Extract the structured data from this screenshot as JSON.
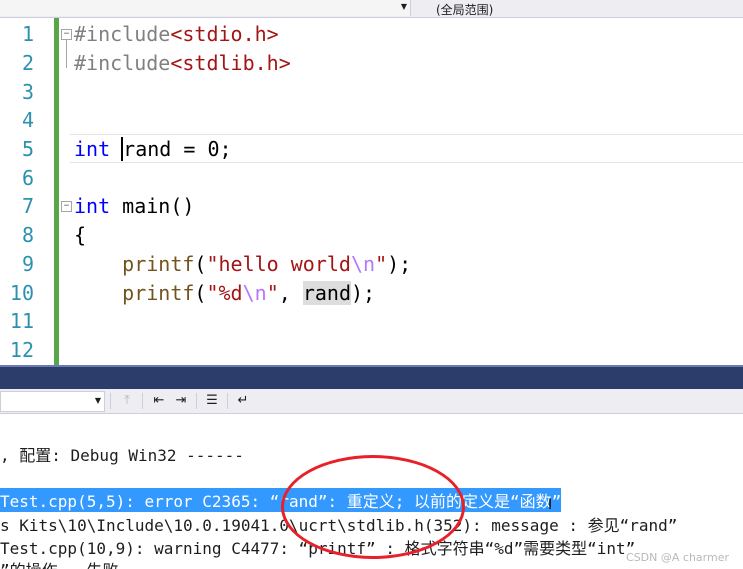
{
  "nav_bar": {
    "scope_label": "(全局范围)"
  },
  "editor": {
    "lines": [
      {
        "num": "1",
        "directive": "#include",
        "header": "<stdio.h>"
      },
      {
        "num": "2",
        "directive": "#include",
        "header": "<stdlib.h>"
      },
      {
        "num": "3"
      },
      {
        "num": "4"
      },
      {
        "num": "5",
        "kw": "int",
        "var": "rand",
        "rest": " = 0;"
      },
      {
        "num": "6"
      },
      {
        "num": "7",
        "kw": "int",
        "rest": " main()"
      },
      {
        "num": "8",
        "rest": "{"
      },
      {
        "num": "9",
        "fn": "printf",
        "open": "(",
        "str_a": "\"hello world",
        "esc": "\\n",
        "str_b": "\"",
        "close": ");"
      },
      {
        "num": "10",
        "fn": "printf",
        "open": "(",
        "str_a": "\"%d",
        "esc": "\\n",
        "str_b": "\"",
        "mid": ", ",
        "var": "rand",
        "close": ");"
      },
      {
        "num": "11"
      },
      {
        "num": "12"
      }
    ]
  },
  "output": {
    "lines": [
      ", 配置: Debug Win32 ------",
      "Test.cpp(5,5): error C2365: “rand”: 重定义; 以前的定义是“函数”",
      "s Kits\\10\\Include\\10.0.19041.0\\ucrt\\stdlib.h(352): message : 参见“rand”",
      "Test.cpp(10,9): warning C4477: “printf” : 格式字符串“%d”需要类型“int”",
      "”的操作 - 失败"
    ]
  },
  "watermark": "CSDN @A charmer",
  "colors": {
    "keyword": "#0000ff",
    "string": "#a31515",
    "line_number": "#2b91af",
    "selection": "#3399ff",
    "annotation": "#e8202a"
  }
}
